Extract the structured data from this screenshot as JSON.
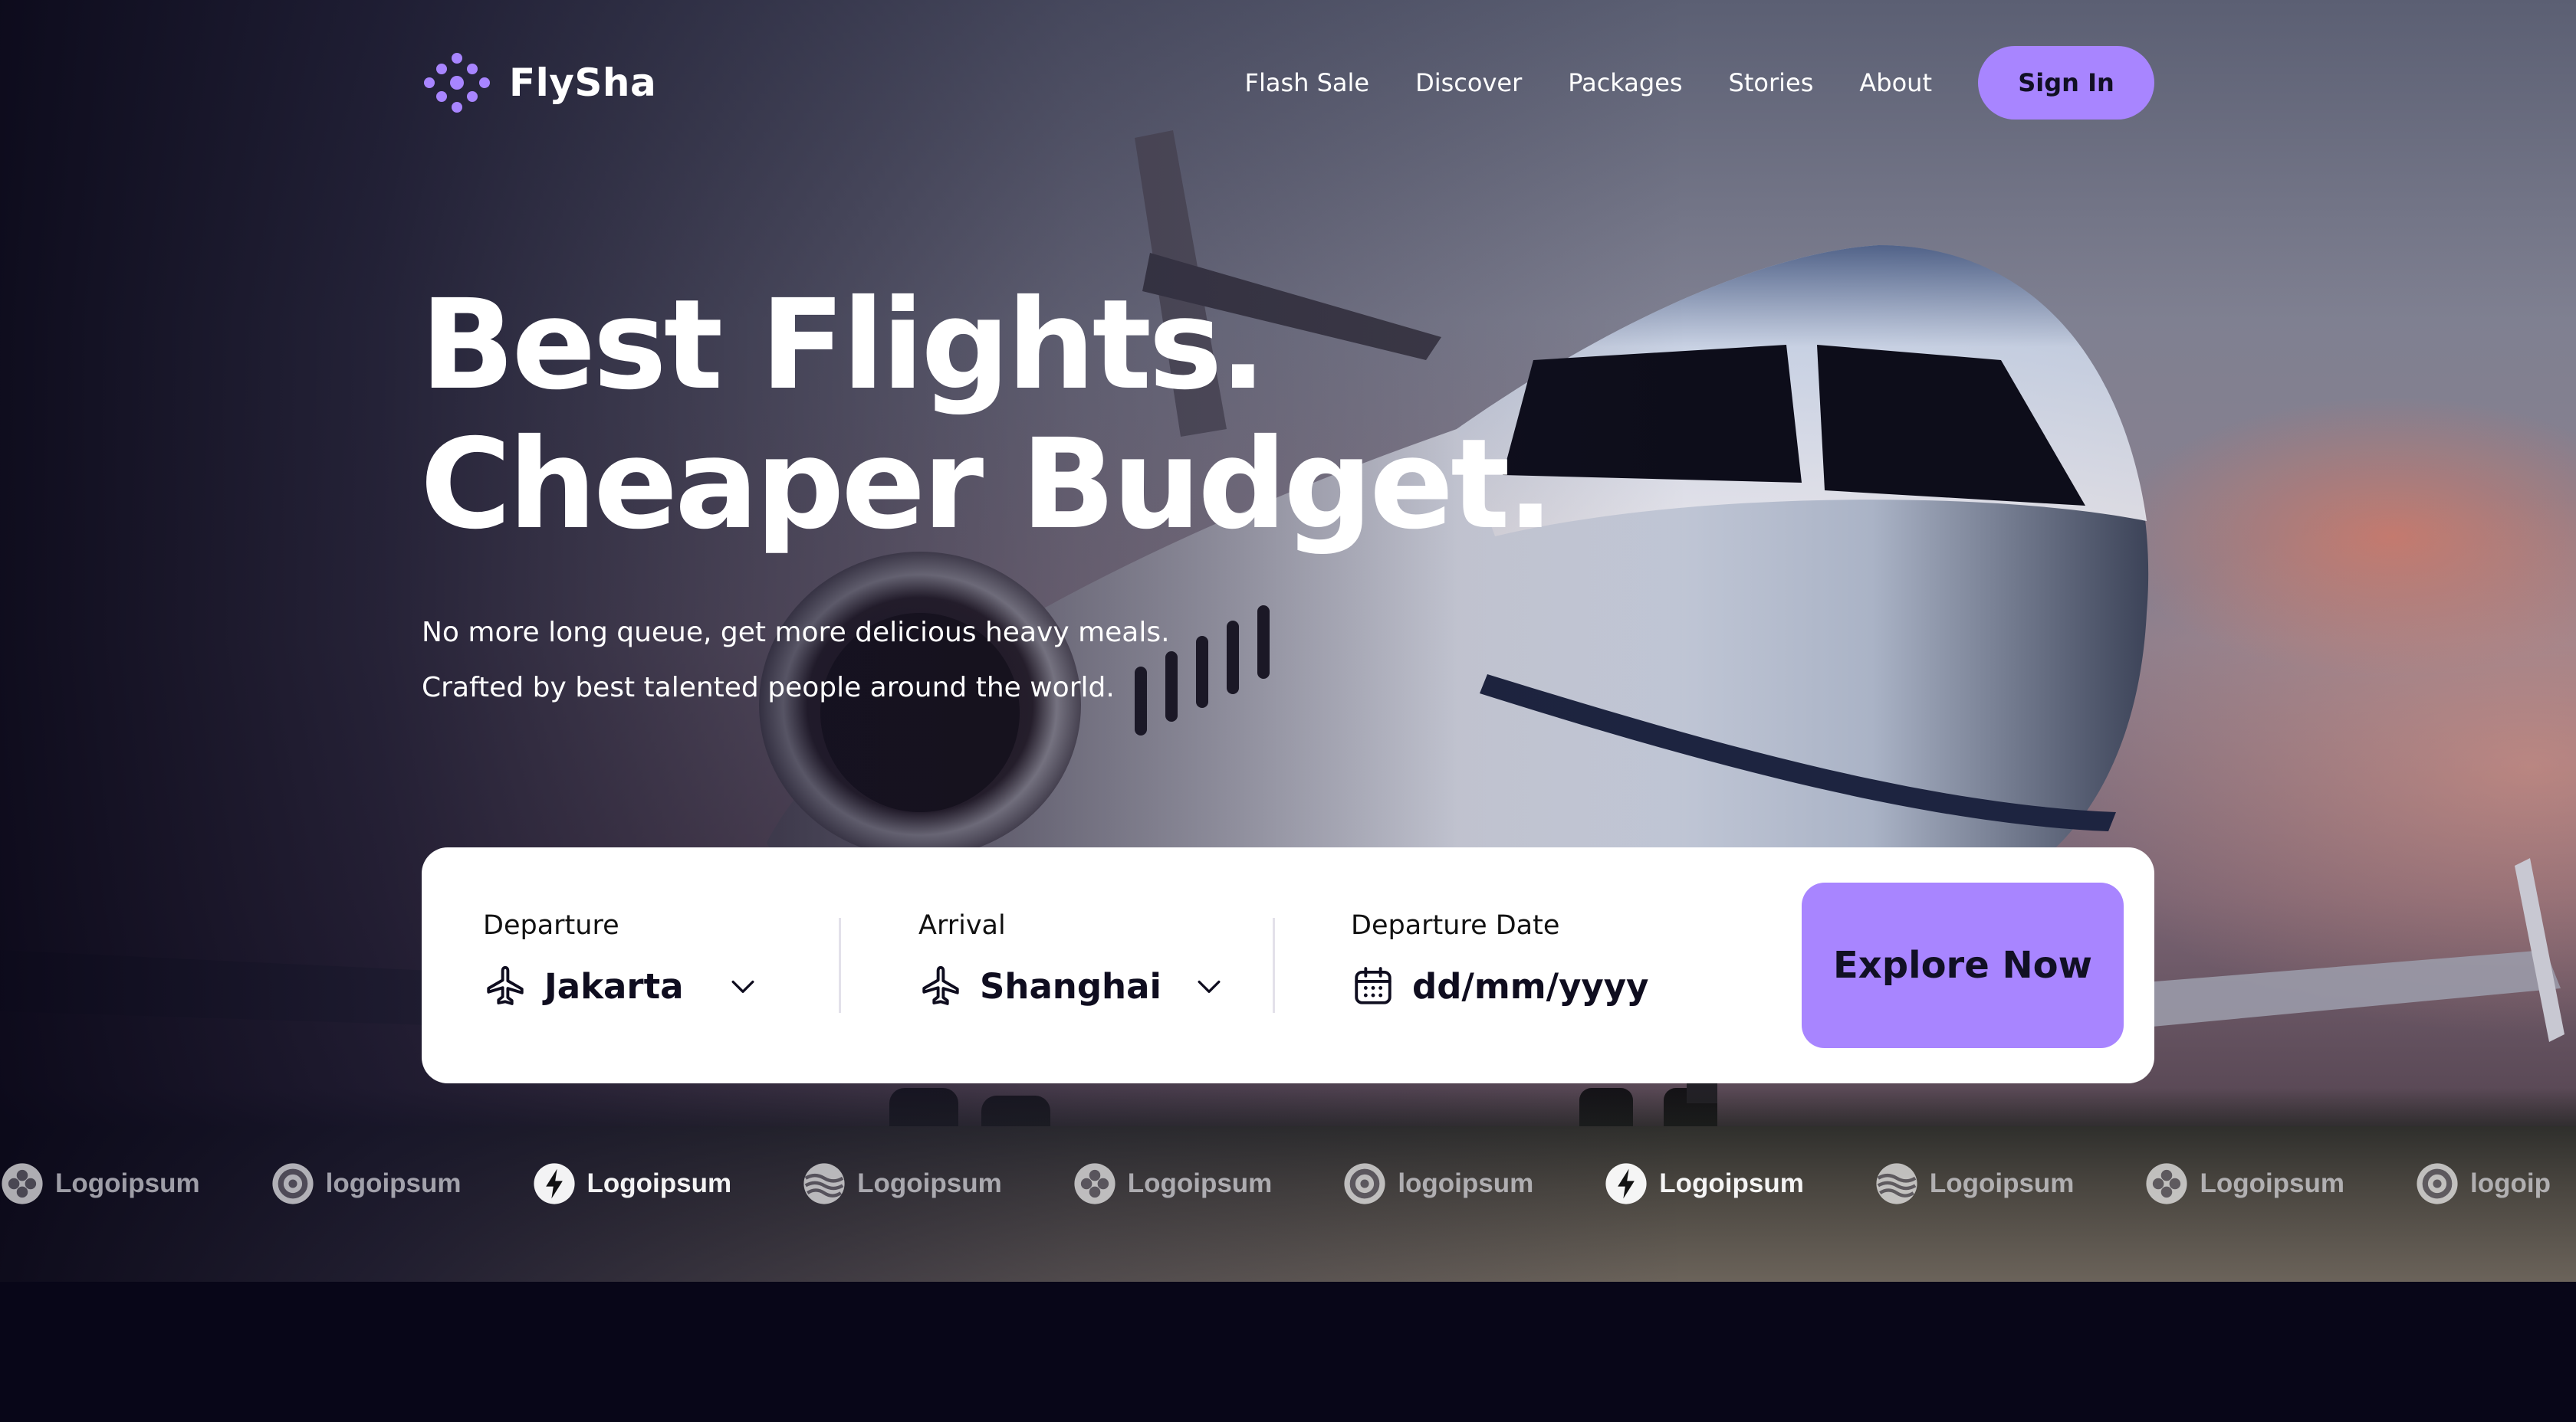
{
  "brand": {
    "name": "FlySha",
    "logo_icon": "dots-logo-icon",
    "accent_color": "#a885ff"
  },
  "nav": {
    "links": [
      "Flash Sale",
      "Discover",
      "Packages",
      "Stories",
      "About"
    ],
    "signin_label": "Sign In"
  },
  "hero": {
    "headline_line1": "Best Flights.",
    "headline_line2": "Cheaper Budget.",
    "subtitle_line1": "No more long queue, get more delicious heavy meals.",
    "subtitle_line2": "Crafted by best talented people around the world."
  },
  "search": {
    "departure": {
      "label": "Departure",
      "value": "Jakarta",
      "icon": "airplane-icon"
    },
    "arrival": {
      "label": "Arrival",
      "value": "Shanghai",
      "icon": "airplane-icon"
    },
    "date": {
      "label": "Departure Date",
      "placeholder": "dd/mm/yyyy",
      "icon": "calendar-icon"
    },
    "submit_label": "Explore Now"
  },
  "partners": [
    {
      "text": "Logoipsum",
      "icon": "clover-logo-icon",
      "style": "dim"
    },
    {
      "text": "logoipsum",
      "icon": "ring-logo-icon",
      "style": "dim"
    },
    {
      "text": "Logoipsum",
      "icon": "bolt-logo-icon",
      "style": "bright"
    },
    {
      "text": "Logoipsum",
      "icon": "globe-wave-logo-icon",
      "style": "dim"
    },
    {
      "text": "Logoipsum",
      "icon": "clover-logo-icon",
      "style": "dim"
    },
    {
      "text": "logoipsum",
      "icon": "ring-logo-icon",
      "style": "dim"
    },
    {
      "text": "Logoipsum",
      "icon": "bolt-logo-icon",
      "style": "bright"
    },
    {
      "text": "Logoipsum",
      "icon": "globe-wave-logo-icon",
      "style": "dim"
    },
    {
      "text": "Logoipsum",
      "icon": "clover-logo-icon",
      "style": "dim"
    },
    {
      "text": "logoip",
      "icon": "ring-logo-icon",
      "style": "dim"
    }
  ]
}
